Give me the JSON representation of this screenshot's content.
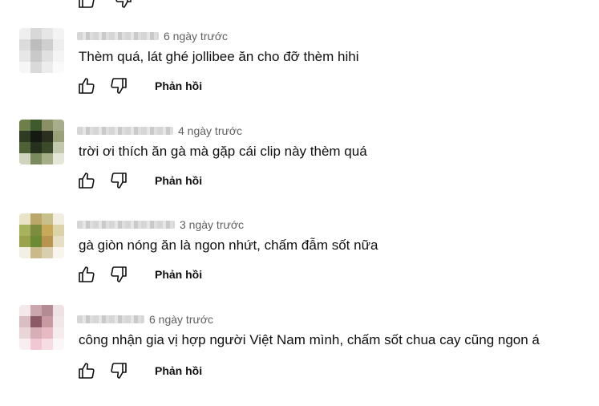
{
  "comments": [
    {
      "time": "6 ngày trước",
      "text": "Thèm quá, lát ghé jollibee ăn cho đỡ thèm hihi",
      "reply_label": "Phản hồi",
      "avatar_colors": [
        "#efefef",
        "#d8d8d8",
        "#e6e6e6",
        "#f3f3f3",
        "#dcdcdc",
        "#bdbdbd",
        "#cfcfcf",
        "#eeeeee",
        "#e7e7e7",
        "#c9c9c9",
        "#e0e0e0",
        "#f4f4f4",
        "#f6f6f6",
        "#d9d9d9",
        "#ececec",
        "#fafafa"
      ]
    },
    {
      "time": "4 ngày trước",
      "text": "trời ơi thích ăn gà mà gặp cái clip này thèm quá",
      "reply_label": "Phản hồi",
      "avatar_colors": [
        "#6f7f4a",
        "#3f5a2c",
        "#8a8f66",
        "#a7ad8b",
        "#2f3b22",
        "#141912",
        "#2a2f20",
        "#9aa07a",
        "#4d6136",
        "#26301c",
        "#3b4a29",
        "#c3c7ad",
        "#d0d4bf",
        "#7b8a5c",
        "#a5ad89",
        "#e4e6d8"
      ]
    },
    {
      "time": "3 ngày trước",
      "text": "gà giòn nóng ăn là ngon nhứt, chấm đẫm sốt nữa",
      "reply_label": "Phản hồi",
      "avatar_colors": [
        "#e9e3c8",
        "#b9a86a",
        "#c7c08b",
        "#f1ede0",
        "#a7b35a",
        "#7d8c3e",
        "#c8a95a",
        "#dcd3a8",
        "#9aa24d",
        "#6a8a34",
        "#b89450",
        "#e6dfc3",
        "#f2efe4",
        "#cbb98a",
        "#d9cfae",
        "#f7f5ee"
      ]
    },
    {
      "time": "6 ngày trước",
      "text": "công nhận gia vị hợp người Việt Nam mình, chấm sốt chua cay cũng ngon á",
      "reply_label": "Phản hồi",
      "avatar_colors": [
        "#f3e9ea",
        "#caa7ad",
        "#b48a93",
        "#efe2e4",
        "#d9bfc3",
        "#8c5a66",
        "#c79aa2",
        "#f1e6e8",
        "#e8d5d8",
        "#d7aeb6",
        "#e7b9c3",
        "#f5ecee",
        "#f8eef1",
        "#f0c7d2",
        "#f6dde4",
        "#fbf6f7"
      ]
    }
  ]
}
